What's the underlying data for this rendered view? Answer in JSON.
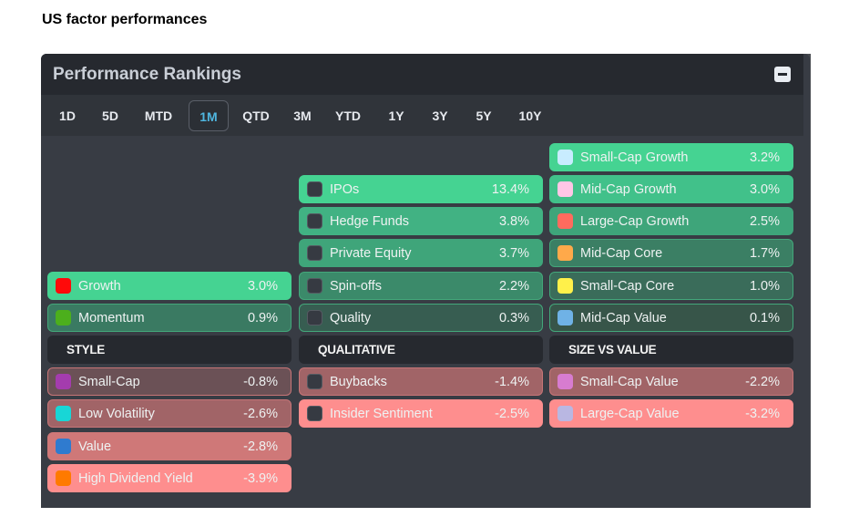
{
  "page_title": "US factor performances",
  "panel": {
    "title": "Performance Rankings",
    "collapse_label": "collapse"
  },
  "tabs": [
    {
      "label": "1D",
      "active": false
    },
    {
      "label": "5D",
      "active": false
    },
    {
      "label": "MTD",
      "active": false
    },
    {
      "label": "1M",
      "active": true
    },
    {
      "label": "QTD",
      "active": false
    },
    {
      "label": "3M",
      "active": false
    },
    {
      "label": "YTD",
      "active": false
    },
    {
      "label": "1Y",
      "active": false
    },
    {
      "label": "3Y",
      "active": false
    },
    {
      "label": "5Y",
      "active": false
    },
    {
      "label": "10Y",
      "active": false
    }
  ],
  "columns": [
    {
      "header": "STYLE",
      "positive": [
        {
          "name": "Growth",
          "value": "3.0%",
          "swatch": "#ff0a0a",
          "bg": "#45d392",
          "border": "#45d392"
        },
        {
          "name": "Momentum",
          "value": "0.9%",
          "swatch": "#4caf1c",
          "bg": "#3a7a62",
          "border": "#43a77a"
        }
      ],
      "negative": [
        {
          "name": "Small-Cap",
          "value": "-0.8%",
          "swatch": "#a43cae",
          "bg": "#6b5156",
          "border": "#c77577"
        },
        {
          "name": "Low Volatility",
          "value": "-2.6%",
          "swatch": "#18d6d6",
          "bg": "#a16467",
          "border": "#c77577"
        },
        {
          "name": "Value",
          "value": "-2.8%",
          "swatch": "#2f7bcf",
          "bg": "#cf7878",
          "border": "#cf7878"
        },
        {
          "name": "High Dividend Yield",
          "value": "-3.9%",
          "swatch": "#ff7a00",
          "bg": "#fe8e8e",
          "border": "#fe8e8e"
        }
      ]
    },
    {
      "header": "QUALITATIVE",
      "positive": [
        {
          "name": "IPOs",
          "value": "13.4%",
          "swatch": "dark",
          "bg": "#45d392",
          "border": "#45d392"
        },
        {
          "name": "Hedge Funds",
          "value": "3.8%",
          "swatch": "dark",
          "bg": "#41b283",
          "border": "#41b283"
        },
        {
          "name": "Private Equity",
          "value": "3.7%",
          "swatch": "dark",
          "bg": "#3fa57a",
          "border": "#3fa57a"
        },
        {
          "name": "Spin-offs",
          "value": "2.2%",
          "swatch": "dark",
          "bg": "#3b8a6a",
          "border": "#43a77a"
        },
        {
          "name": "Quality",
          "value": "0.3%",
          "swatch": "dark",
          "bg": "#375d51",
          "border": "#43a77a"
        }
      ],
      "negative": [
        {
          "name": "Buybacks",
          "value": "-1.4%",
          "swatch": "dark",
          "bg": "#a16467",
          "border": "#c77577"
        },
        {
          "name": "Insider Sentiment",
          "value": "-2.5%",
          "swatch": "dark",
          "bg": "#fe8e8e",
          "border": "#fe8e8e"
        }
      ]
    },
    {
      "header": "SIZE VS VALUE",
      "positive": [
        {
          "name": "Small-Cap Growth",
          "value": "3.2%",
          "swatch": "#c8ecff",
          "bg": "#45d392",
          "border": "#45d392"
        },
        {
          "name": "Mid-Cap Growth",
          "value": "3.0%",
          "swatch": "#ffc6e6",
          "bg": "#41c18a",
          "border": "#41c18a"
        },
        {
          "name": "Large-Cap Growth",
          "value": "2.5%",
          "swatch": "#ff6b5e",
          "bg": "#3ea57a",
          "border": "#3ea57a"
        },
        {
          "name": "Mid-Cap Core",
          "value": "1.7%",
          "swatch": "#ffa94a",
          "bg": "#3b7f64",
          "border": "#43a77a"
        },
        {
          "name": "Small-Cap Core",
          "value": "1.0%",
          "swatch": "#fff04a",
          "bg": "#3a6c5a",
          "border": "#43a77a"
        },
        {
          "name": "Mid-Cap Value",
          "value": "0.1%",
          "swatch": "#6fb2e6",
          "bg": "#375549",
          "border": "#43a77a"
        }
      ],
      "negative": [
        {
          "name": "Small-Cap Value",
          "value": "-2.2%",
          "swatch": "#d77cd0",
          "bg": "#a16467",
          "border": "#c77577"
        },
        {
          "name": "Large-Cap Value",
          "value": "-3.2%",
          "swatch": "#b9b7e2",
          "bg": "#fe8e8e",
          "border": "#fe8e8e"
        }
      ]
    }
  ]
}
